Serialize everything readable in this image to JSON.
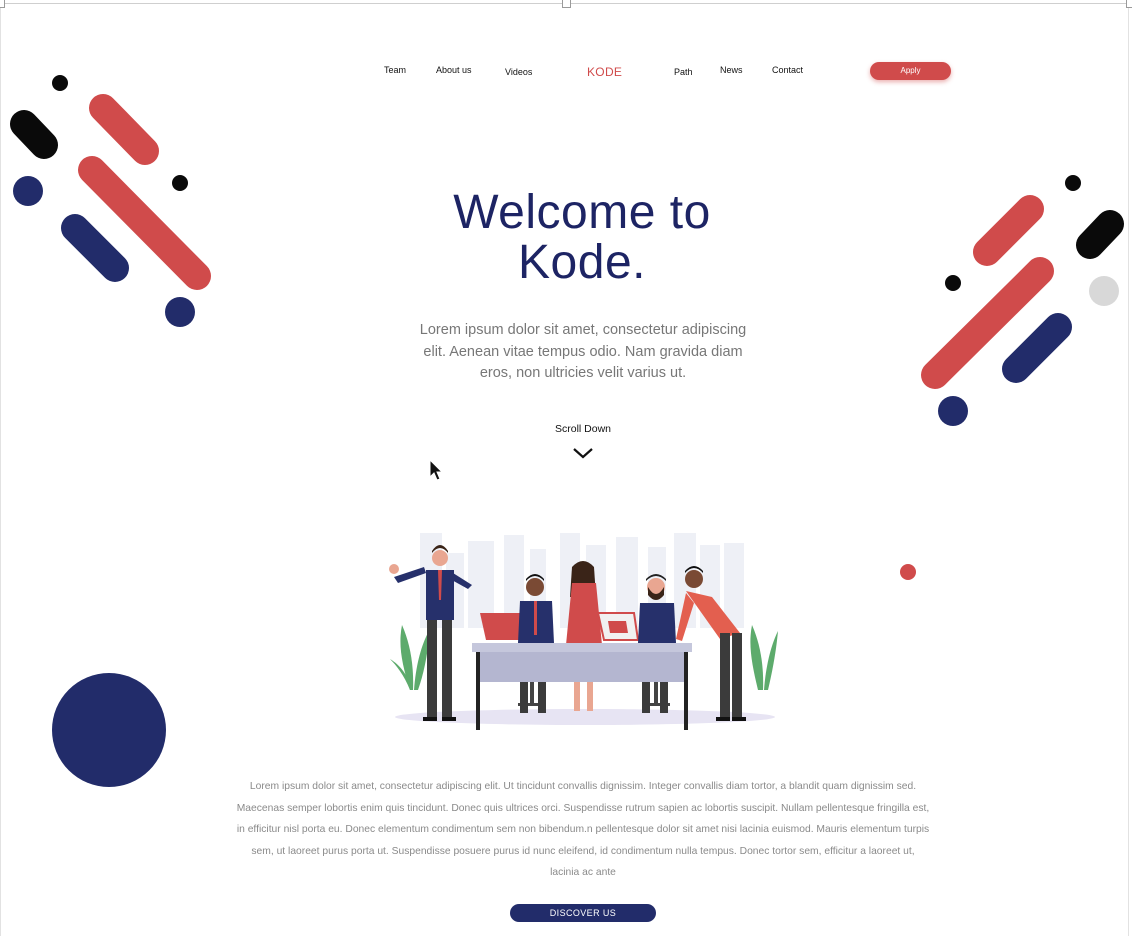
{
  "nav": {
    "links": [
      "Team",
      "About us",
      "Videos",
      "Path",
      "News",
      "Contact"
    ],
    "brand": "KODE",
    "apply_label": "Apply"
  },
  "hero": {
    "title_line1": "Welcome to",
    "title_line2": "Kode.",
    "subtitle": "Lorem ipsum dolor sit amet, consectetur adipiscing elit. Aenean vitae tempus odio. Nam gravida diam eros, non ultricies velit varius ut.",
    "scroll_label": "Scroll Down"
  },
  "content": {
    "paragraph": "Lorem ipsum dolor sit amet, consectetur adipiscing elit. Ut tincidunt convallis dignissim. Integer convallis diam tortor, a blandit quam dignissim sed. Maecenas semper lobortis enim quis tincidunt. Donec quis ultrices orci. Suspendisse rutrum sapien ac lobortis suscipit. Nullam pellentesque fringilla est, in efficitur nisl porta eu. Donec elementum condimentum sem non bibendum.n pellentesque dolor sit amet nisi lacinia euismod. Mauris elementum turpis sem, ut laoreet purus porta ut. Suspendisse posuere purus id nunc eleifend, id condimentum nulla tempus. Donec tortor sem, efficitur a laoreet ut, lacinia ac ante",
    "cta_label": "DISCOVER US"
  },
  "icons": {
    "scroll": "chevron-down-icon",
    "pointer": "mouse-cursor-icon"
  },
  "colors": {
    "brand_red": "#d04b4b",
    "navy": "#222c6a",
    "title_navy": "#1d2464",
    "black": "#000000",
    "grey": "#d8d8d8"
  }
}
